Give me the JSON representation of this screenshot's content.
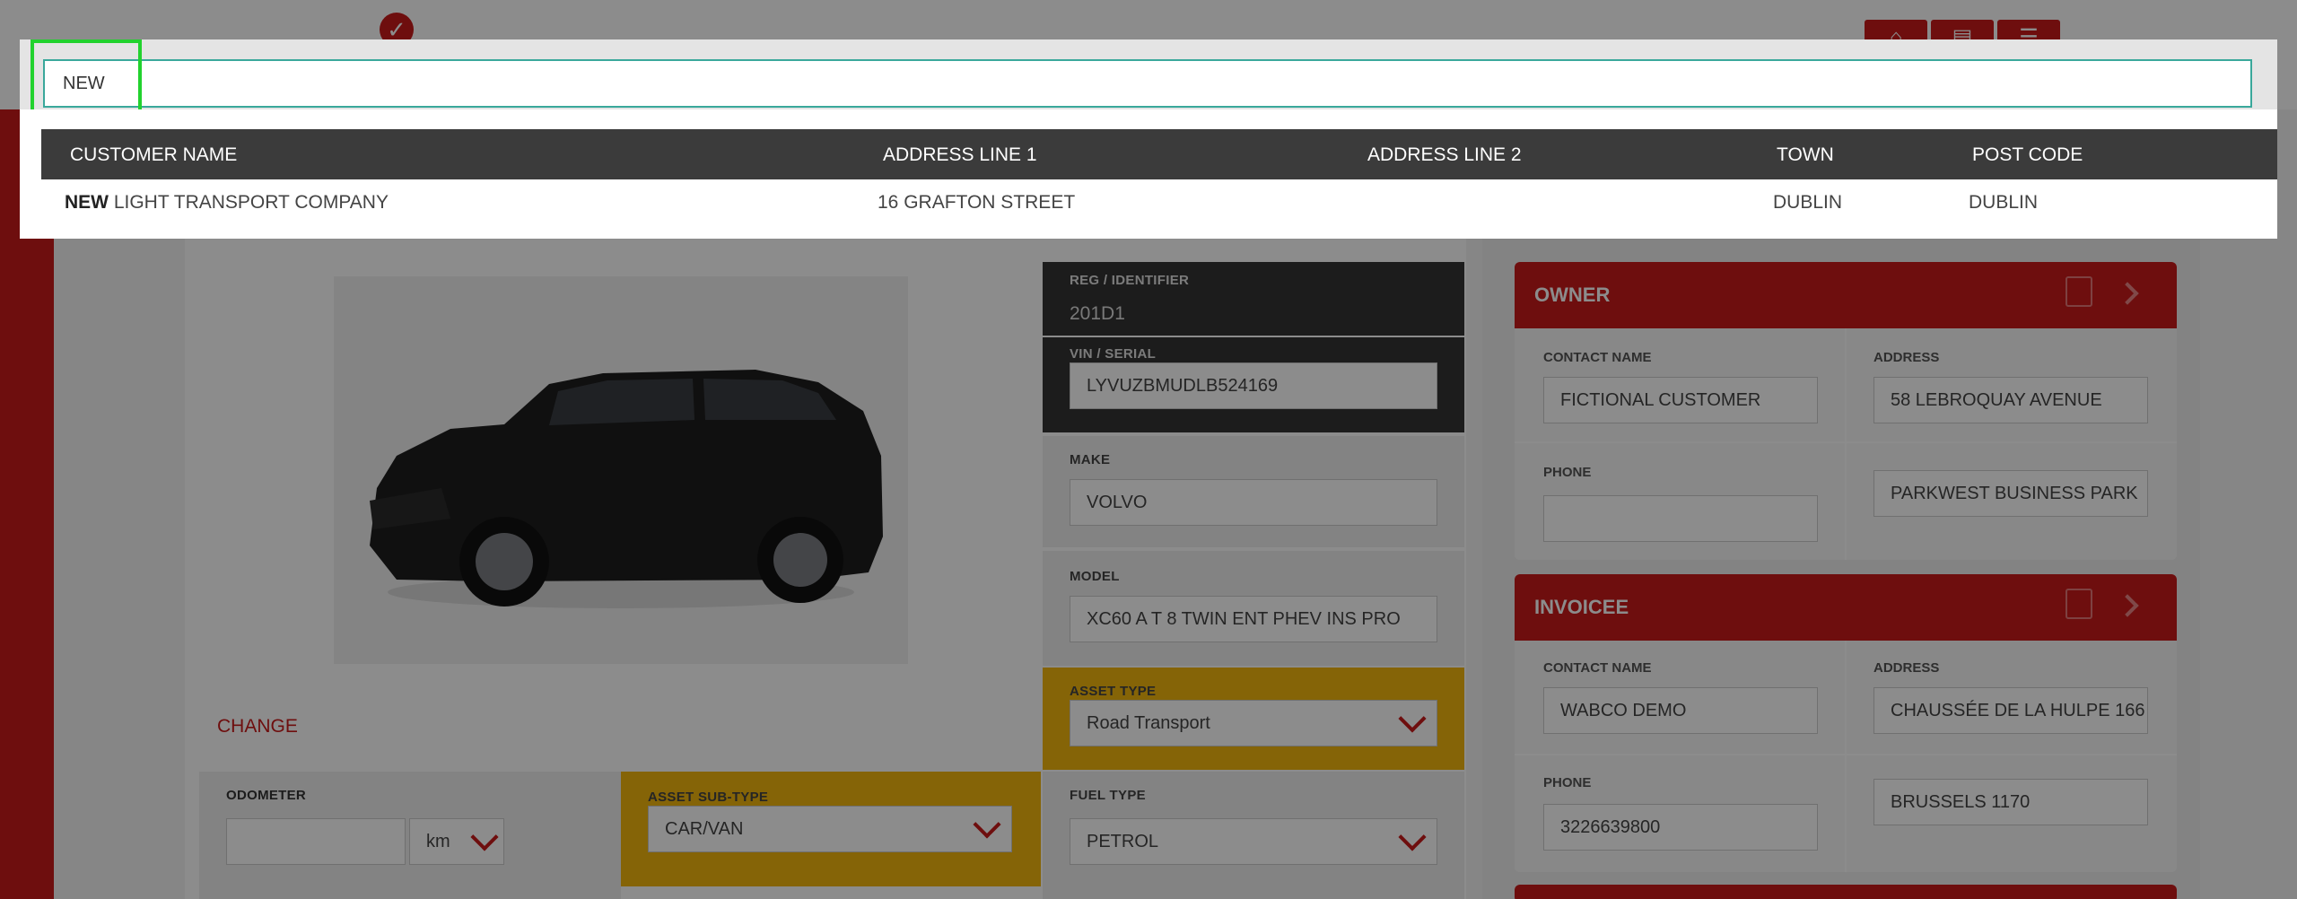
{
  "search": {
    "value": "NEW",
    "focus_color": "#22d22e"
  },
  "results": {
    "columns": [
      "CUSTOMER NAME",
      "ADDRESS LINE 1",
      "ADDRESS LINE 2",
      "TOWN",
      "POST CODE"
    ],
    "rows": [
      {
        "name_match": "NEW",
        "name_rest": " LIGHT TRANSPORT COMPANY",
        "address1": "16 GRAFTON STREET",
        "address2": "",
        "town": "DUBLIN",
        "post_code": "DUBLIN"
      }
    ]
  },
  "vehicle": {
    "change_label": "CHANGE",
    "reg_label": "REG / IDENTIFIER",
    "reg_value": "201D1",
    "vin_label": "VIN / SERIAL",
    "vin_value": "LYVUZBMUDLB524169",
    "make_label": "MAKE",
    "make_value": "VOLVO",
    "model_label": "MODEL",
    "model_value": "XC60 A T 8 TWIN ENT PHEV INS PRO",
    "asset_type_label": "ASSET TYPE",
    "asset_type_value": "Road Transport",
    "odometer_label": "ODOMETER",
    "odometer_value": "",
    "odometer_unit": "km",
    "asset_subtype_label": "ASSET SUB-TYPE",
    "asset_subtype_value": "CAR/VAN",
    "fuel_type_label": "FUEL TYPE",
    "fuel_type_value": "PETROL"
  },
  "owner": {
    "title": "OWNER",
    "contact_label": "CONTACT NAME",
    "contact_value": "FICTIONAL CUSTOMER",
    "address_label": "ADDRESS",
    "address_line1": "58 LEBROQUAY AVENUE",
    "phone_label": "PHONE",
    "phone_value": "",
    "address_line2": "PARKWEST BUSINESS PARK"
  },
  "invoicee": {
    "title": "INVOICEE",
    "contact_label": "CONTACT NAME",
    "contact_value": "WABCO DEMO",
    "address_label": "ADDRESS",
    "address_line1": "CHAUSSÉE DE LA HULPE 166",
    "phone_label": "PHONE",
    "phone_value": "3226639800",
    "address_line2": "BRUSSELS 1170"
  },
  "colors": {
    "brand_red": "#c81a1a",
    "asset_yellow": "#f2b60e",
    "header_dark": "#3b3b3b",
    "input_border": "#3aa89b"
  }
}
